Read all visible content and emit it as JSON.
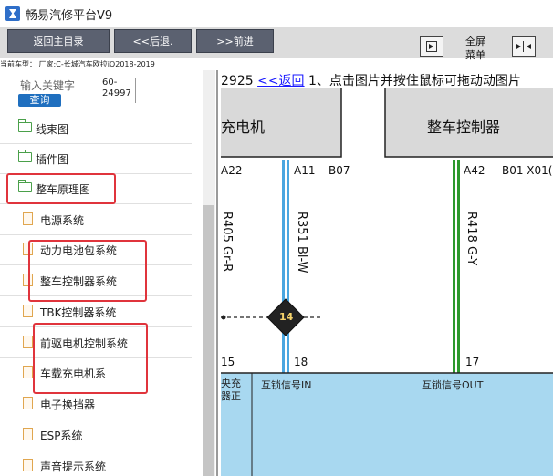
{
  "window": {
    "title": "畅易汽修平台V9"
  },
  "toolbar": {
    "home": "返回主目录",
    "back": "<<后退.",
    "forward": ">>前进",
    "fullscreen": "全屏\n菜单"
  },
  "car_info": "当前车型：  厂家:C-长城汽车欧拉iQ2018-2019",
  "search": {
    "label": "输入关键字",
    "value": "60-24997",
    "button": "查询"
  },
  "sidebar": {
    "items": [
      {
        "label": "线束图",
        "icon": "folder-icon"
      },
      {
        "label": "插件图",
        "icon": "folder-icon"
      },
      {
        "label": "整车原理图",
        "icon": "folder-open-icon"
      },
      {
        "label": "电源系统",
        "icon": "document-icon"
      },
      {
        "label": "动力电池包系统",
        "icon": "document-icon"
      },
      {
        "label": "整车控制器系统",
        "icon": "document-icon"
      },
      {
        "label": "TBK控制器系统",
        "icon": "document-icon"
      },
      {
        "label": "前驱电机控制系统",
        "icon": "document-icon"
      },
      {
        "label": "车载充电机系",
        "icon": "document-icon"
      },
      {
        "label": "电子换挡器",
        "icon": "document-icon"
      },
      {
        "label": "ESP系统",
        "icon": "document-icon"
      },
      {
        "label": "声音提示系统",
        "icon": "document-icon"
      }
    ]
  },
  "content": {
    "code": "2925",
    "back_link": "<<返回",
    "instruction": "1、点击图片并按住鼠标可拖动动图片"
  },
  "diagram": {
    "left_box": "充电机",
    "right_box": "整车控制器",
    "pins_top": [
      "A22",
      "A11",
      "B07",
      "A42",
      "B01-X01("
    ],
    "wires": [
      "R405 Gr-R",
      "R351 Bl-W",
      "R418 G-Y"
    ],
    "splice": "14",
    "pins_bottom": [
      "15",
      "18",
      "17"
    ],
    "signals": [
      "互锁信号IN",
      "互锁信号OUT"
    ],
    "left_fragment": "央充\n器正",
    "colors": {
      "blue_wire": "#4aa6e0",
      "green_wire": "#2e9a2e",
      "bottom_block": "#a8d8f0",
      "component_box": "#d9d9d9",
      "top_strip": "#8fc5e0"
    }
  },
  "highlight_color": "#e0343c"
}
